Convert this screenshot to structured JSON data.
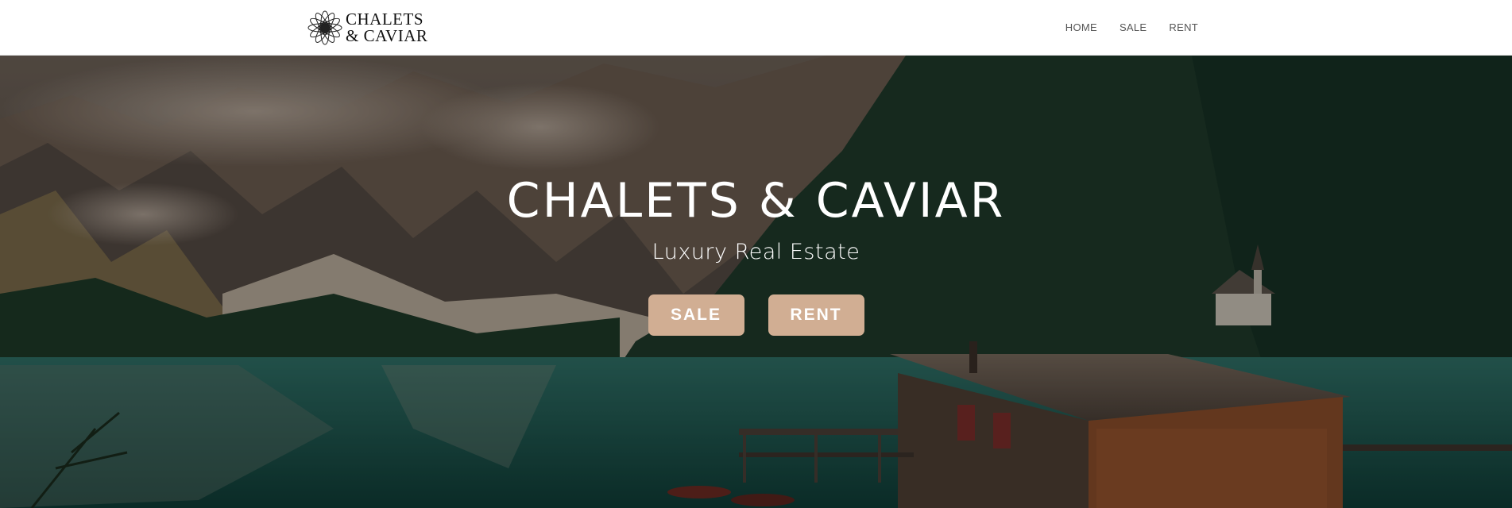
{
  "logo": {
    "line1": "CHALETS",
    "line2": "& CAVIAR",
    "icon": "lotus-flower-icon"
  },
  "nav": {
    "items": [
      {
        "label": "HOME"
      },
      {
        "label": "SALE"
      },
      {
        "label": "RENT"
      }
    ]
  },
  "hero": {
    "title": "CHALETS & CAVIAR",
    "subtitle": "Luxury Real Estate",
    "buttons": [
      {
        "label": "SALE"
      },
      {
        "label": "RENT"
      }
    ],
    "background": "mountain-lake-with-wooden-boathouse-photo"
  },
  "colors": {
    "accent": "#d1ae93",
    "header_bg": "#ffffff",
    "nav_text": "#555555",
    "hero_text": "#ffffff"
  }
}
